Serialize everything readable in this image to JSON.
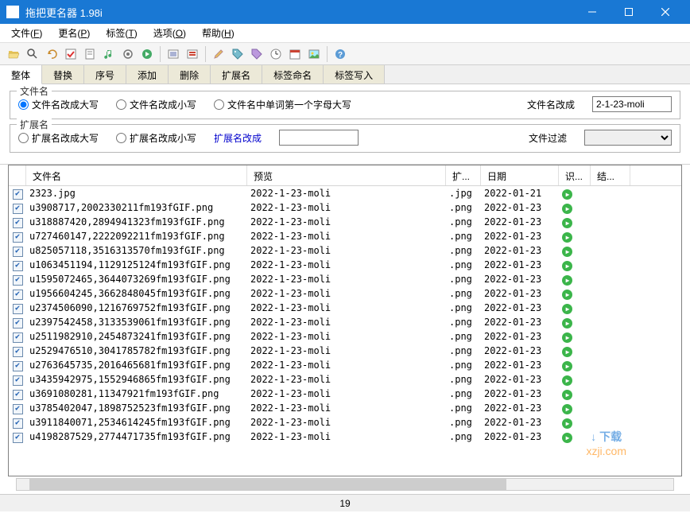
{
  "window": {
    "title": "拖把更名器 1.98i"
  },
  "menus": [
    {
      "label": "文件",
      "key": "F"
    },
    {
      "label": "更名",
      "key": "P"
    },
    {
      "label": "标签",
      "key": "T"
    },
    {
      "label": "选项",
      "key": "O"
    },
    {
      "label": "帮助",
      "key": "H"
    }
  ],
  "toolbar_icons": [
    "folder-open-icon",
    "search-icon",
    "undo-icon",
    "check-icon",
    "document-icon",
    "music-note-icon",
    "music-gear-icon",
    "music-play-icon",
    "sep",
    "list-icon",
    "list-bold-icon",
    "sep",
    "edit-pencil-icon",
    "tag-icon",
    "music-tag-icon",
    "clock-icon",
    "clock-date-icon",
    "image-icon",
    "sep",
    "help-icon"
  ],
  "tabs": [
    {
      "label": "整体",
      "active": true
    },
    {
      "label": "替换",
      "active": false
    },
    {
      "label": "序号",
      "active": false
    },
    {
      "label": "添加",
      "active": false
    },
    {
      "label": "删除",
      "active": false
    },
    {
      "label": "扩展名",
      "active": false
    },
    {
      "label": "标签命名",
      "active": false
    },
    {
      "label": "标签写入",
      "active": false
    }
  ],
  "filename_group": {
    "title": "文件名",
    "opt1": "文件名改成大写",
    "opt2": "文件名改成小写",
    "opt3": "文件名中单词第一个字母大写",
    "rename_label": "文件名改成",
    "rename_value": "2-1-23-moli"
  },
  "ext_group": {
    "title": "扩展名",
    "opt1": "扩展名改成大写",
    "opt2": "扩展名改成小写",
    "ext_to_label": "扩展名改成",
    "ext_to_value": "",
    "filter_label": "文件过滤",
    "filter_value": ""
  },
  "columns": {
    "name": "文件名",
    "preview": "预览",
    "ext": "扩...",
    "date": "日期",
    "id": "识...",
    "res": "结..."
  },
  "rows": [
    {
      "name": "2323.jpg",
      "preview": "2022-1-23-moli",
      "ext": ".jpg",
      "date": "2022-01-21"
    },
    {
      "name": "u3908717,2002330211fm193fGIF.png",
      "preview": "2022-1-23-moli",
      "ext": ".png",
      "date": "2022-01-23"
    },
    {
      "name": "u318887420,2894941323fm193fGIF.png",
      "preview": "2022-1-23-moli",
      "ext": ".png",
      "date": "2022-01-23"
    },
    {
      "name": "u727460147,2222092211fm193fGIF.png",
      "preview": "2022-1-23-moli",
      "ext": ".png",
      "date": "2022-01-23"
    },
    {
      "name": "u825057118,3516313570fm193fGIF.png",
      "preview": "2022-1-23-moli",
      "ext": ".png",
      "date": "2022-01-23"
    },
    {
      "name": "u1063451194,1129125124fm193fGIF.png",
      "preview": "2022-1-23-moli",
      "ext": ".png",
      "date": "2022-01-23"
    },
    {
      "name": "u1595072465,3644073269fm193fGIF.png",
      "preview": "2022-1-23-moli",
      "ext": ".png",
      "date": "2022-01-23"
    },
    {
      "name": "u1956604245,3662848045fm193fGIF.png",
      "preview": "2022-1-23-moli",
      "ext": ".png",
      "date": "2022-01-23"
    },
    {
      "name": "u2374506090,1216769752fm193fGIF.png",
      "preview": "2022-1-23-moli",
      "ext": ".png",
      "date": "2022-01-23"
    },
    {
      "name": "u2397542458,3133539061fm193fGIF.png",
      "preview": "2022-1-23-moli",
      "ext": ".png",
      "date": "2022-01-23"
    },
    {
      "name": "u2511982910,2454873241fm193fGIF.png",
      "preview": "2022-1-23-moli",
      "ext": ".png",
      "date": "2022-01-23"
    },
    {
      "name": "u2529476510,3041785782fm193fGIF.png",
      "preview": "2022-1-23-moli",
      "ext": ".png",
      "date": "2022-01-23"
    },
    {
      "name": "u2763645735,2016465681fm193fGIF.png",
      "preview": "2022-1-23-moli",
      "ext": ".png",
      "date": "2022-01-23"
    },
    {
      "name": "u3435942975,1552946865fm193fGIF.png",
      "preview": "2022-1-23-moli",
      "ext": ".png",
      "date": "2022-01-23"
    },
    {
      "name": "u3691080281,11347921fm193fGIF.png",
      "preview": "2022-1-23-moli",
      "ext": ".png",
      "date": "2022-01-23"
    },
    {
      "name": "u3785402047,1898752523fm193fGIF.png",
      "preview": "2022-1-23-moli",
      "ext": ".png",
      "date": "2022-01-23"
    },
    {
      "name": "u3911840071,2534614245fm193fGIF.png",
      "preview": "2022-1-23-moli",
      "ext": ".png",
      "date": "2022-01-23"
    },
    {
      "name": "u4198287529,2774471735fm193fGIF.png",
      "preview": "2022-1-23-moli",
      "ext": ".png",
      "date": "2022-01-23"
    }
  ],
  "status": {
    "count": "19"
  },
  "watermark": {
    "l1": "下载",
    "l2": "xzji.com"
  }
}
